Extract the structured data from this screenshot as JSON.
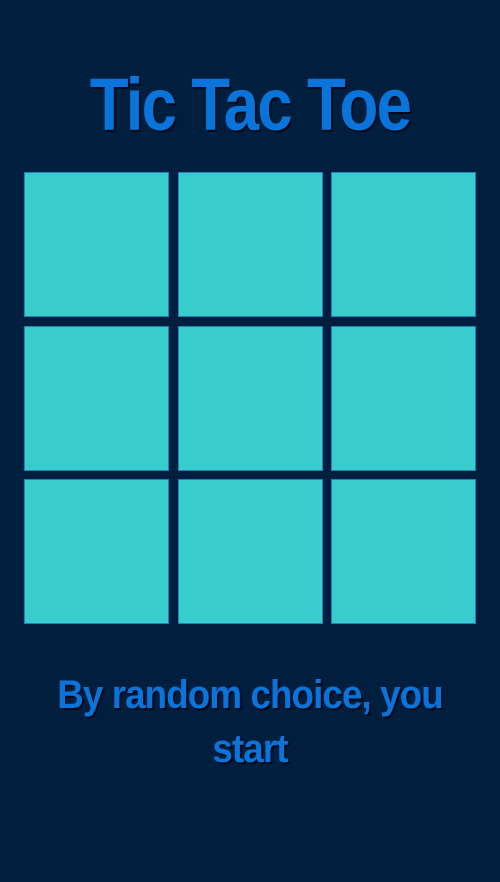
{
  "game": {
    "title": "Tic Tac Toe",
    "status": "By random choice, you start"
  },
  "board": {
    "cells": [
      "",
      "",
      "",
      "",
      "",
      "",
      "",
      "",
      ""
    ]
  },
  "colors": {
    "background": "#001f3f",
    "cell": "#39cccc",
    "text": "#0a74da"
  }
}
